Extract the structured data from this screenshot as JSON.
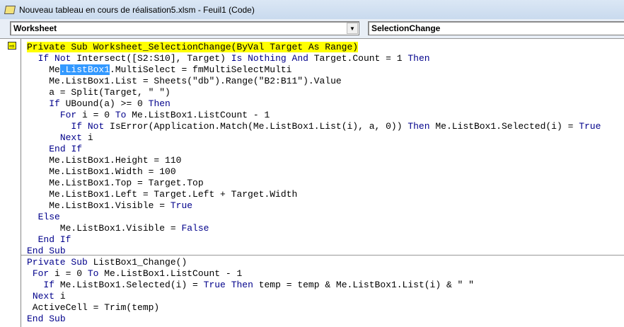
{
  "window": {
    "title": "Nouveau tableau en cours de réalisation5.xlsm - Feuil1 (Code)"
  },
  "toolbar": {
    "object": "Worksheet",
    "procedure": "SelectionChange"
  },
  "code": {
    "proc1": [
      "Private Sub Worksheet_SelectionChange(ByVal Target As Range)",
      "  If Not Intersect([S2:S10], Target) Is Nothing And Target.Count = 1 Then",
      "    Me.ListBox1.MultiSelect = fmMultiSelectMulti",
      "    Me.ListBox1.List = Sheets(\"db\").Range(\"B2:B11\").Value",
      "    a = Split(Target, \" \")",
      "    If UBound(a) >= 0 Then",
      "      For i = 0 To Me.ListBox1.ListCount - 1",
      "        If Not IsError(Application.Match(Me.ListBox1.List(i), a, 0)) Then Me.ListBox1.Selected(i) = True",
      "      Next i",
      "    End If",
      "    Me.ListBox1.Height = 110",
      "    Me.ListBox1.Width = 100",
      "    Me.ListBox1.Top = Target.Top",
      "    Me.ListBox1.Left = Target.Left + Target.Width",
      "    Me.ListBox1.Visible = True",
      "  Else",
      "      Me.ListBox1.Visible = False",
      "  End If",
      "End Sub"
    ],
    "proc2": [
      "Private Sub ListBox1_Change()",
      " For i = 0 To Me.ListBox1.ListCount - 1",
      "   If Me.ListBox1.Selected(i) = True Then temp = temp & Me.ListBox1.List(i) & \" \"",
      " Next i",
      " ActiveCell = Trim(temp)",
      "End Sub"
    ]
  },
  "selection": ".ListBox1"
}
